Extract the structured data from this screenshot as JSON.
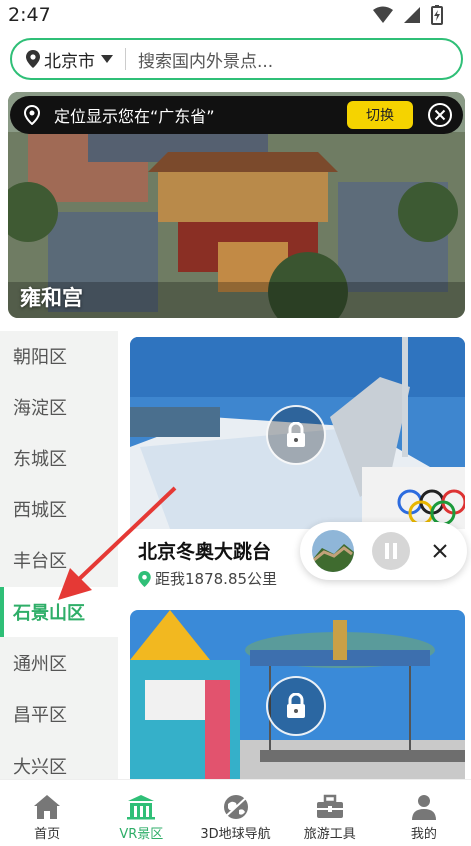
{
  "status_bar": {
    "time": "2:47"
  },
  "search": {
    "city": "北京市",
    "placeholder": "搜索国内外景点..."
  },
  "location_banner": {
    "text": "定位显示您在“广东省”",
    "switch_label": "切换"
  },
  "hero": {
    "title": "雍和宫"
  },
  "sidebar": {
    "items": [
      {
        "label": "朝阳区",
        "active": false
      },
      {
        "label": "海淀区",
        "active": false
      },
      {
        "label": "东城区",
        "active": false
      },
      {
        "label": "西城区",
        "active": false
      },
      {
        "label": "丰台区",
        "active": false
      },
      {
        "label": "石景山区",
        "active": true
      },
      {
        "label": "通州区",
        "active": false
      },
      {
        "label": "昌平区",
        "active": false
      },
      {
        "label": "大兴区",
        "active": false
      }
    ]
  },
  "cards": [
    {
      "title": "北京冬奥大跳台",
      "distance": "距我1878.85公里",
      "locked": true
    },
    {
      "title": "",
      "distance": "",
      "locked": true
    }
  ],
  "bottom_nav": {
    "items": [
      {
        "label": "首页",
        "icon": "home-icon",
        "active": false
      },
      {
        "label": "VR景区",
        "icon": "vr-scenic-icon",
        "active": true
      },
      {
        "label": "3D地球导航",
        "icon": "globe-icon",
        "active": false
      },
      {
        "label": "旅游工具",
        "icon": "toolbox-icon",
        "active": false
      },
      {
        "label": "我的",
        "icon": "user-icon",
        "active": false
      }
    ]
  },
  "colors": {
    "accent": "#2fbf77",
    "banner_button": "#f5d300",
    "arrow": "#e53935"
  }
}
